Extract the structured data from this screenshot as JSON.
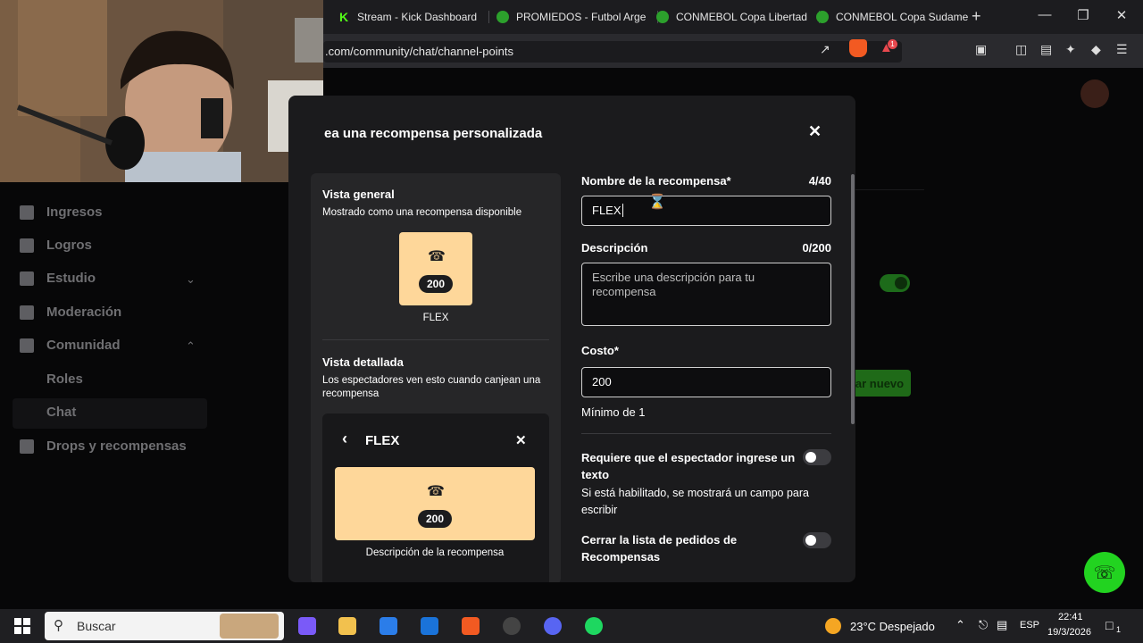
{
  "browser": {
    "tabs": [
      {
        "label": "Stream - Kick Dashboard",
        "fav_letter": "K",
        "fav_color": "#53fc18"
      },
      {
        "label": "PROMIEDOS - Futbol Arge",
        "fav_letter": "",
        "fav_color": "#2ca02c"
      },
      {
        "label": "CONMEBOL Copa Libertad",
        "fav_letter": "",
        "fav_color": "#2ca02c"
      },
      {
        "label": "CONMEBOL Copa Sudame",
        "fav_letter": "",
        "fav_color": "#2ca02c"
      }
    ],
    "new_tab": "+",
    "url": ".com/community/chat/channel-points",
    "brave_badge": "1"
  },
  "sidebar": {
    "items": [
      {
        "label": "Ingresos"
      },
      {
        "label": "Logros"
      },
      {
        "label": "Estudio"
      },
      {
        "label": "Moderación"
      },
      {
        "label": "Comunidad"
      },
      {
        "label": "Drops y recompensas"
      }
    ],
    "sub_items": [
      {
        "label": "Roles"
      },
      {
        "label": "Chat"
      }
    ]
  },
  "background": {
    "create_button": "ar nuevo"
  },
  "modal": {
    "title": "ea una recompensa personalizada",
    "preview": {
      "general_heading": "Vista general",
      "general_sub": "Mostrado como una recompensa disponible",
      "cost": "200",
      "reward_name": "FLEX",
      "detail_heading": "Vista detallada",
      "detail_sub": "Los espectadores ven esto cuando canjean una recompensa",
      "detail_title": "FLEX",
      "detail_cost": "200",
      "detail_description": "Descripción de la recompensa"
    },
    "form": {
      "name_label": "Nombre de la recompensa*",
      "name_count": "4/40",
      "name_value": "FLEX",
      "desc_label": "Descripción",
      "desc_count": "0/200",
      "desc_placeholder": "Escribe una descripción para tu recompensa",
      "cost_label": "Costo*",
      "cost_value": "200",
      "cost_helper": "Mínimo de 1",
      "require_text_label": "Requiere que el espectador ingrese un texto",
      "require_text_helper": "Si está habilitado, se mostrará un campo para escribir",
      "require_text_on": false,
      "close_list_label": "Cerrar la lista de pedidos de Recompensas",
      "close_list_on": false
    }
  },
  "taskbar": {
    "search_placeholder": "Buscar",
    "weather": "23°C  Despejado",
    "lang": "ESP",
    "time": "22:41",
    "date": "19/3/2026",
    "notif_count": "1"
  },
  "colors": {
    "kick_green": "#53fc18",
    "reward_card": "#fed79a",
    "modal_bg": "#1b1b1d"
  }
}
